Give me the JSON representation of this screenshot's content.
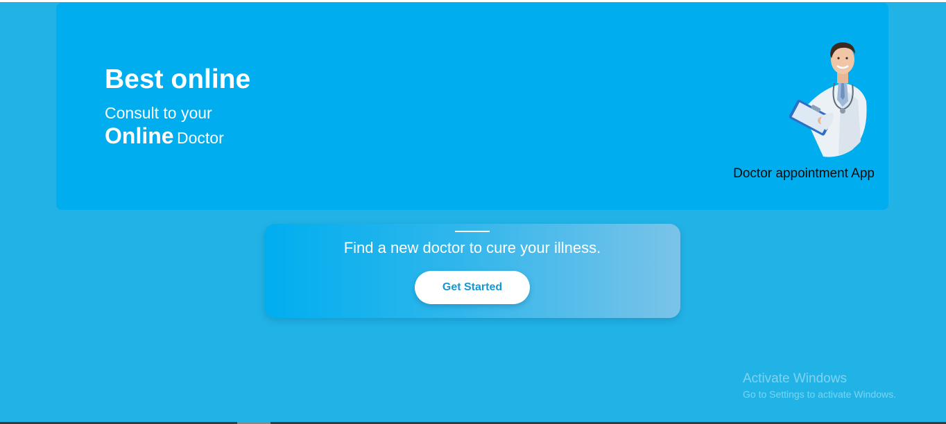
{
  "hero": {
    "title": "Best online",
    "subtitle_line1": "Consult to your",
    "subtitle_strong": "Online",
    "subtitle_rest": "Doctor",
    "caption": "Doctor appointment App",
    "image_icon": "doctor-with-clipboard-illustration"
  },
  "cta": {
    "text": "Find a new doctor to cure your illness.",
    "button_label": "Get Started"
  },
  "watermark": {
    "title": "Activate Windows",
    "subtitle": "Go to Settings to activate Windows."
  },
  "colors": {
    "page_background": "#22b3e6",
    "hero_background": "#00aeef",
    "button_text": "#1398d6",
    "caption_text": "#0a0a0a"
  }
}
